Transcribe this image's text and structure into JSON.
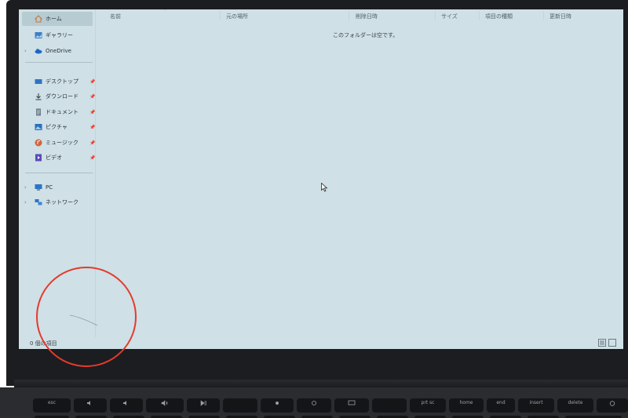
{
  "nav": {
    "items": [
      {
        "label": "ホーム",
        "icon": "home-icon",
        "expandable": false,
        "pinned": false,
        "active": true
      },
      {
        "label": "ギャラリー",
        "icon": "gallery-icon",
        "expandable": false,
        "pinned": false
      },
      {
        "label": "OneDrive",
        "icon": "cloud-icon",
        "expandable": true,
        "pinned": false
      },
      {
        "label": "デスクトップ",
        "icon": "desktop-icon",
        "expandable": false,
        "pinned": true
      },
      {
        "label": "ダウンロード",
        "icon": "download-icon",
        "expandable": false,
        "pinned": true
      },
      {
        "label": "ドキュメント",
        "icon": "document-icon",
        "expandable": false,
        "pinned": true
      },
      {
        "label": "ピクチャ",
        "icon": "pictures-icon",
        "expandable": false,
        "pinned": true
      },
      {
        "label": "ミュージック",
        "icon": "music-icon",
        "expandable": false,
        "pinned": true
      },
      {
        "label": "ビデオ",
        "icon": "video-icon",
        "expandable": false,
        "pinned": true
      },
      {
        "label": "PC",
        "icon": "pc-icon",
        "expandable": true,
        "pinned": false
      },
      {
        "label": "ネットワーク",
        "icon": "network-icon",
        "expandable": true,
        "pinned": false
      }
    ]
  },
  "columns": [
    "名前",
    "元の場所",
    "削除日時",
    "サイズ",
    "項目の種類",
    "更新日時"
  ],
  "main": {
    "empty_message": "このフォルダーは空です。"
  },
  "status": {
    "item_count": "0 個の項目"
  },
  "keyboard": {
    "keys": [
      "esc",
      "",
      "",
      "",
      "",
      "",
      "",
      "",
      "",
      "prt sc",
      "home",
      "end",
      "insert",
      "delete",
      ""
    ]
  },
  "colors": {
    "screen_bg": "#cfe0e6",
    "bezel": "#1c1d20",
    "annotation": "#e53a2c"
  }
}
